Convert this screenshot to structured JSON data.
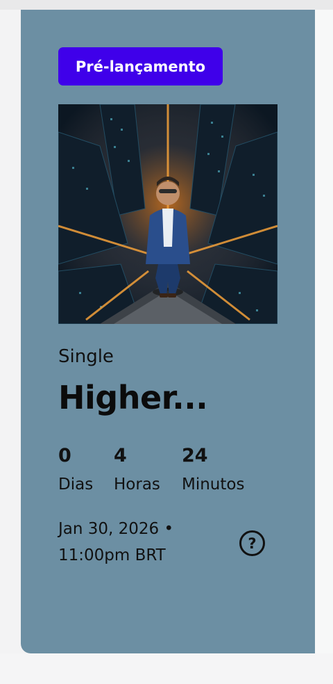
{
  "colors": {
    "card_background": "#6c8fa3",
    "badge_background": "#3f00ea",
    "page_background": "#f3f3f4"
  },
  "release": {
    "badge_label": "Pré-lançamento",
    "cover_alt": "Album cover: man in blue suit standing on skyscraper rooftop above night city",
    "type_label": "Single",
    "title": "Higher...",
    "countdown": [
      {
        "value": "0",
        "label": "Dias"
      },
      {
        "value": "4",
        "label": "Horas"
      },
      {
        "value": "24",
        "label": "Minutos"
      }
    ],
    "date_line1": "Jan 30, 2026 •",
    "date_line2": "11:00pm BRT",
    "help_icon": "question-circle-icon",
    "help_symbol": "?"
  }
}
